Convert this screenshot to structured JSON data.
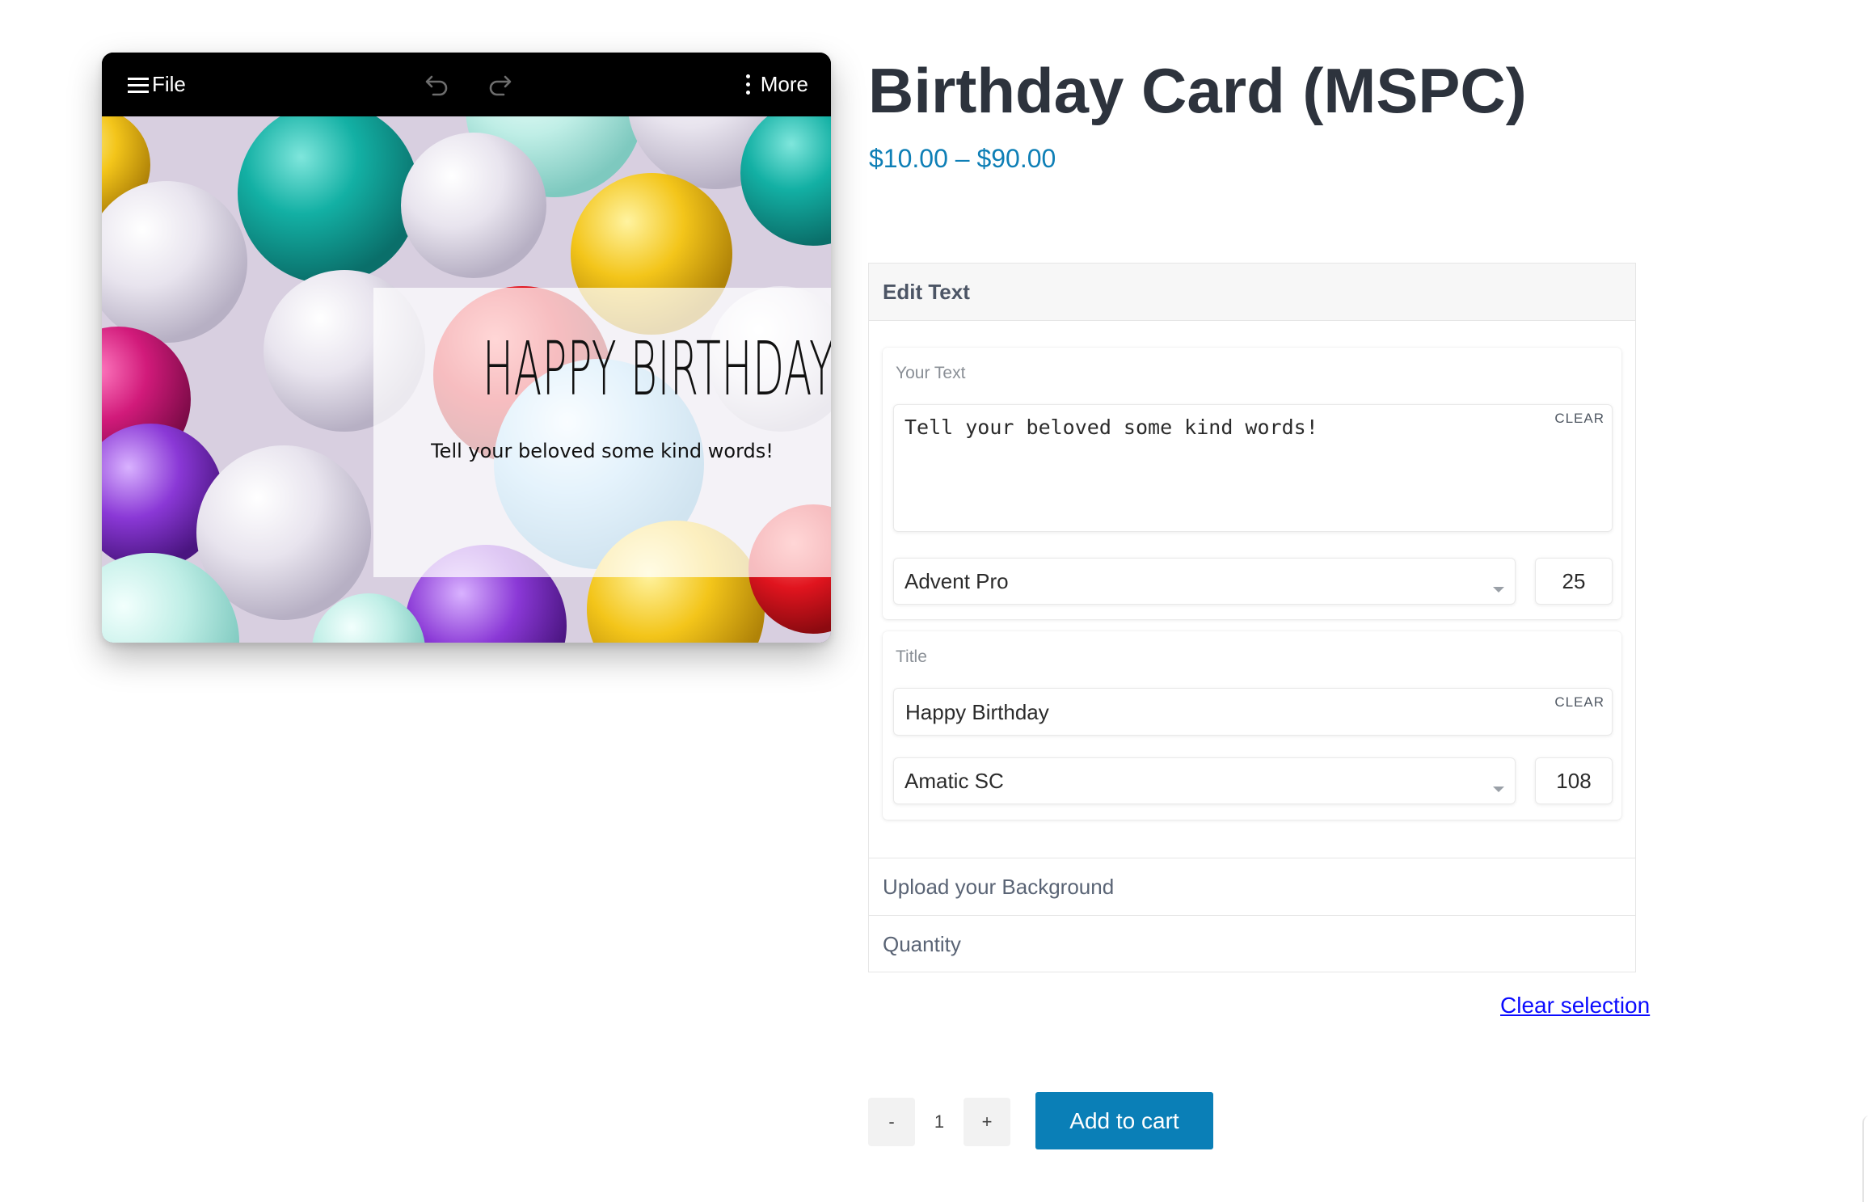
{
  "editor": {
    "file_label": "File",
    "more_label": "More",
    "card": {
      "title": "Happy Birthday",
      "subtitle": "Tell your beloved some kind words!"
    }
  },
  "product": {
    "title": "Birthday Card (MSPC)",
    "price": "$10.00 – $90.00"
  },
  "options": {
    "edit_text_label": "Edit Text",
    "your_text": {
      "label": "Your Text",
      "value": "Tell your beloved some kind words!",
      "clear_label": "CLEAR",
      "font": "Advent Pro",
      "size": "25"
    },
    "title": {
      "label": "Title",
      "value": "Happy Birthday",
      "clear_label": "CLEAR",
      "font": "Amatic SC",
      "size": "108"
    },
    "upload_label": "Upload your Background",
    "quantity_label": "Quantity"
  },
  "clear_selection_label": "Clear selection",
  "cart": {
    "minus_label": "-",
    "quantity": "1",
    "plus_label": "+",
    "add_label": "Add to cart"
  },
  "colors": {
    "price": "#0e7fb6",
    "button": "#0a7fb7",
    "link": "#0a0aff"
  }
}
